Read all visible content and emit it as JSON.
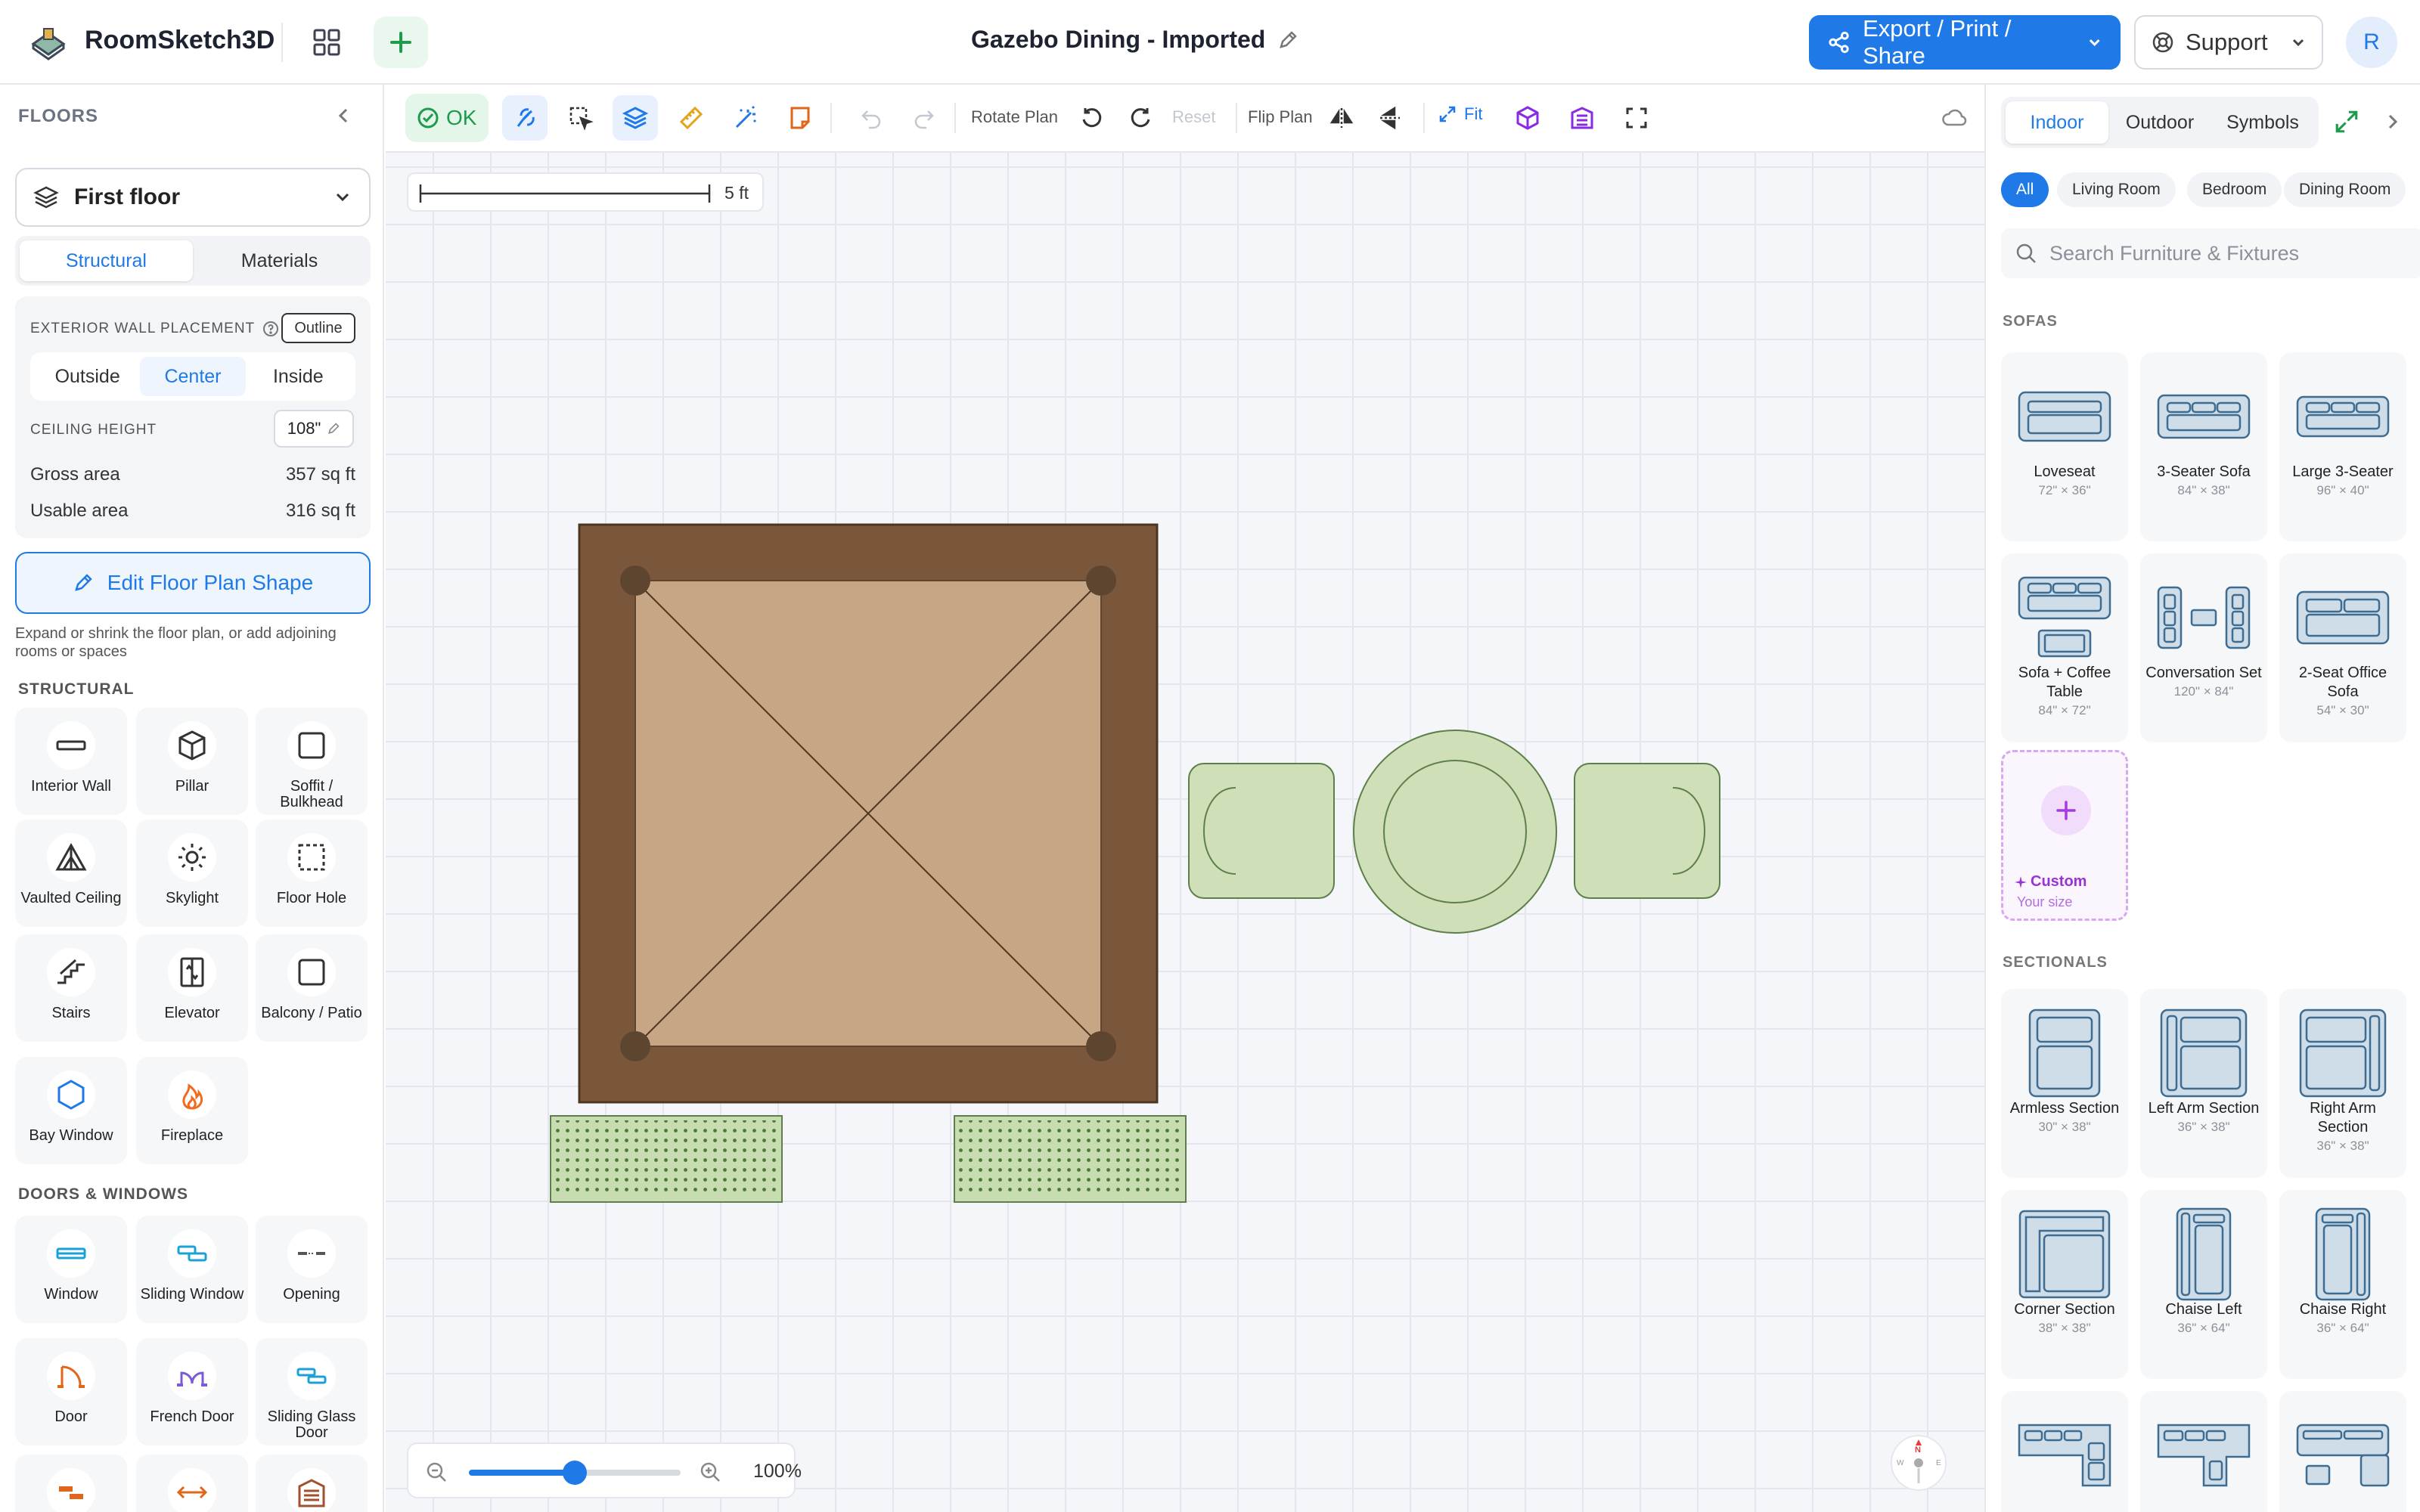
{
  "app": {
    "name": "RoomSketch3D",
    "doc_title": "Gazebo Dining - Imported",
    "export_label": "Export / Print / Share",
    "support_label": "Support",
    "avatar_initial": "R",
    "accent": "#1f7ae8"
  },
  "left": {
    "header": "FLOORS",
    "floor_selected": "First floor",
    "tabs": [
      "Structural",
      "Materials"
    ],
    "wall_placement_label": "EXTERIOR WALL PLACEMENT",
    "outline_label": "Outline",
    "wall_options": [
      "Outside",
      "Center",
      "Inside"
    ],
    "ceiling_label": "CEILING HEIGHT",
    "ceiling_value": "108\"",
    "gross_label": "Gross area",
    "gross_value": "357 sq ft",
    "usable_label": "Usable area",
    "usable_value": "316 sq ft",
    "edit_shape_label": "Edit Floor Plan Shape",
    "edit_hint": "Expand or shrink the floor plan, or add adjoining rooms or spaces",
    "structural_header": "STRUCTURAL",
    "structural": [
      "Interior Wall",
      "Pillar",
      "Soffit / Bulkhead",
      "Vaulted Ceiling",
      "Skylight",
      "Floor Hole",
      "Stairs",
      "Elevator",
      "Balcony / Patio",
      "Bay Window",
      "Fireplace"
    ],
    "doors_header": "DOORS & WINDOWS",
    "doors": [
      "Window",
      "Sliding Window",
      "Opening",
      "Door",
      "French Door",
      "Sliding Glass Door"
    ]
  },
  "toolbar": {
    "ok_label": "OK",
    "rotate_label": "Rotate Plan",
    "reset_label": "Reset",
    "flip_label": "Flip Plan",
    "fit_label": "Fit"
  },
  "canvas": {
    "scale_label": "5 ft",
    "zoom_label": "100%",
    "zoom_level": 0.5,
    "compass_n": "N",
    "compass_w": "W",
    "compass_e": "E"
  },
  "right": {
    "tabs": [
      "Indoor",
      "Outdoor",
      "Symbols"
    ],
    "chips": [
      "All",
      "Living Room",
      "Bedroom",
      "Dining Room"
    ],
    "search_placeholder": "Search Furniture & Fixtures",
    "sofas_header": "SOFAS",
    "sofas": [
      {
        "name": "Loveseat",
        "dims": "72\" × 36\""
      },
      {
        "name": "3-Seater Sofa",
        "dims": "84\" × 38\""
      },
      {
        "name": "Large 3-Seater",
        "dims": "96\" × 40\""
      },
      {
        "name": "Sofa + Coffee Table",
        "dims": "84\" × 72\""
      },
      {
        "name": "Conversation Set",
        "dims": "120\" × 84\""
      },
      {
        "name": "2-Seat Office Sofa",
        "dims": "54\" × 30\""
      }
    ],
    "custom_label": "Custom",
    "custom_sub": "Your size",
    "sectionals_header": "SECTIONALS",
    "sectionals": [
      {
        "name": "Armless Section",
        "dims": "30\" × 38\""
      },
      {
        "name": "Left Arm Section",
        "dims": "36\" × 38\""
      },
      {
        "name": "Right Arm Section",
        "dims": "36\" × 38\""
      },
      {
        "name": "Corner Section",
        "dims": "38\" × 38\""
      },
      {
        "name": "Chaise Left",
        "dims": "36\" × 64\""
      },
      {
        "name": "Chaise Right",
        "dims": "36\" × 64\""
      }
    ]
  }
}
